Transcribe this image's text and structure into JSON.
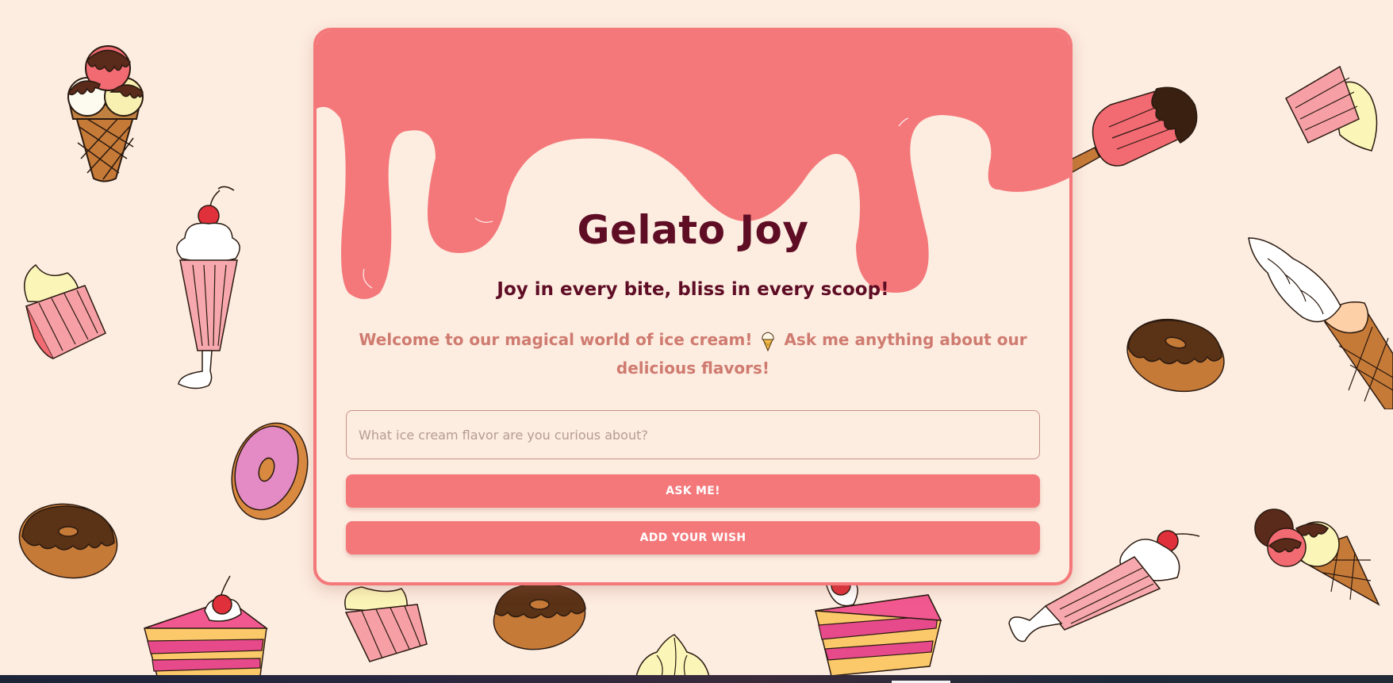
{
  "app": {
    "title": "Gelato Joy",
    "tagline": "Joy in every bite, bliss in every scoop!",
    "welcome_before_icon": "Welcome to our magical world of ice cream!",
    "welcome_icon": "ice-cream-cone-icon",
    "welcome_after_icon": "Ask me anything about our delicious flavors!"
  },
  "form": {
    "question_placeholder": "What ice cream flavor are you curious about?",
    "question_value": "",
    "ask_label": "ASK ME!",
    "wish_label": "ADD YOUR WISH"
  },
  "background_icons": [
    "triple-scoop-cone-icon",
    "milkshake-icon",
    "cupcake-icon",
    "donut-icon",
    "cake-slice-icon",
    "popsicle-icon",
    "soft-serve-cone-icon",
    "meringue-icon"
  ],
  "colors": {
    "background": "#fdece0",
    "accent": "#f4787a",
    "title": "#5e0d25",
    "welcome_text": "#cf7b70",
    "chocolate": "#5a3216",
    "donut_dough": "#c67a38",
    "pink_glaze": "#e48ac4",
    "vanilla": "#fbf5b8"
  }
}
